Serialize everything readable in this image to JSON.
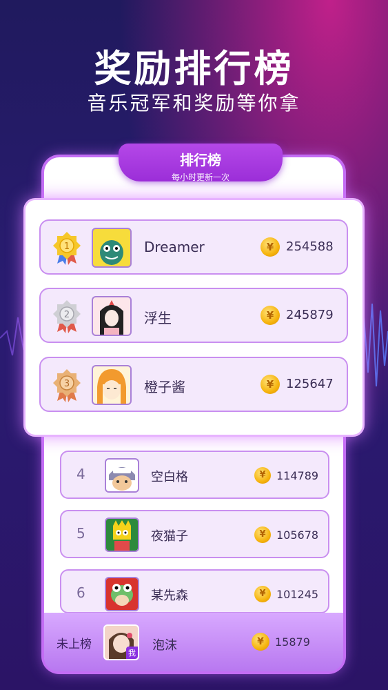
{
  "hero": {
    "title": "奖励排行榜",
    "subtitle": "音乐冠军和奖励等你拿"
  },
  "board": {
    "tab_title": "排行榜",
    "tab_subtitle": "每小时更新一次"
  },
  "coin_symbol": "¥",
  "top3": [
    {
      "rank": "1",
      "medal": "gold-medal-icon",
      "name": "Dreamer",
      "score": "254588"
    },
    {
      "rank": "2",
      "medal": "silver-medal-icon",
      "name": "浮生",
      "score": "245879"
    },
    {
      "rank": "3",
      "medal": "bronze-medal-icon",
      "name": "橙子酱",
      "score": "125647"
    }
  ],
  "list": [
    {
      "rank": "4",
      "name": "空白格",
      "score": "114789"
    },
    {
      "rank": "5",
      "name": "夜猫子",
      "score": "105678"
    },
    {
      "rank": "6",
      "name": "某先森",
      "score": "101245"
    }
  ],
  "me": {
    "rank_label": "未上榜",
    "name": "泡沫",
    "score": "15879",
    "tag": "我"
  },
  "colors": {
    "accent": "#9b2ed8",
    "gold": "#f6b40e",
    "silver": "#c8c8cc",
    "bronze": "#e3a05c"
  }
}
